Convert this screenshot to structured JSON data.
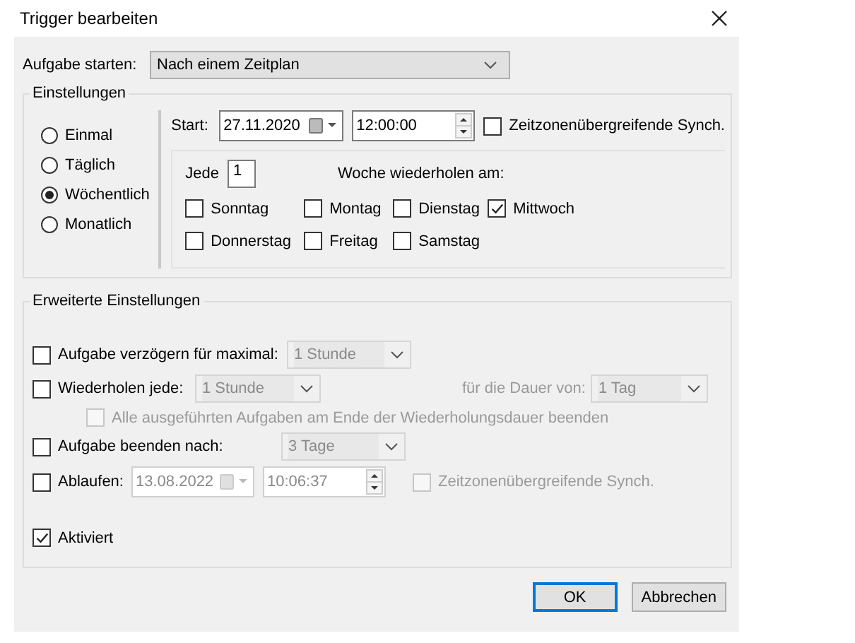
{
  "window": {
    "title": "Trigger bearbeiten"
  },
  "start_task": {
    "label": "Aufgabe starten:",
    "value": "Nach einem Zeitplan"
  },
  "settings": {
    "title": "Einstellungen",
    "schedules": [
      {
        "label": "Einmal",
        "selected": false
      },
      {
        "label": "Täglich",
        "selected": false
      },
      {
        "label": "Wöchentlich",
        "selected": true
      },
      {
        "label": "Monatlich",
        "selected": false
      }
    ],
    "start": {
      "label": "Start:",
      "date": "27.11.2020",
      "time": "12:00:00",
      "sync": {
        "label": "Zeitzonenübergreifende Synch.",
        "checked": false
      }
    },
    "every": {
      "label": "Jede",
      "value": "1",
      "suffix": "Woche wiederholen am:"
    },
    "days": [
      {
        "label": "Sonntag",
        "checked": false
      },
      {
        "label": "Montag",
        "checked": false
      },
      {
        "label": "Dienstag",
        "checked": false
      },
      {
        "label": "Mittwoch",
        "checked": true
      },
      {
        "label": "Donnerstag",
        "checked": false
      },
      {
        "label": "Freitag",
        "checked": false
      },
      {
        "label": "Samstag",
        "checked": false
      }
    ]
  },
  "advanced": {
    "title": "Erweiterte Einstellungen",
    "delay": {
      "label": "Aufgabe verzögern für maximal:",
      "checked": false,
      "value": "1 Stunde"
    },
    "repeat": {
      "label": "Wiederholen jede:",
      "checked": false,
      "value": "1 Stunde",
      "duration_label": "für die Dauer von:",
      "duration": "1 Tag",
      "stop_all": {
        "label": "Alle ausgeführten Aufgaben am Ende der Wiederholungsdauer beenden",
        "checked": false
      }
    },
    "stop_after": {
      "label": "Aufgabe beenden nach:",
      "checked": false,
      "value": "3 Tage"
    },
    "expire": {
      "label": "Ablaufen:",
      "checked": false,
      "date": "13.08.2022",
      "time": "10:06:37",
      "sync": {
        "label": "Zeitzonenübergreifende Synch.",
        "checked": false
      }
    },
    "enabled": {
      "label": "Aktiviert",
      "checked": true
    }
  },
  "buttons": [
    {
      "label": "OK",
      "default": true
    },
    {
      "label": "Abbrechen",
      "default": false
    }
  ]
}
